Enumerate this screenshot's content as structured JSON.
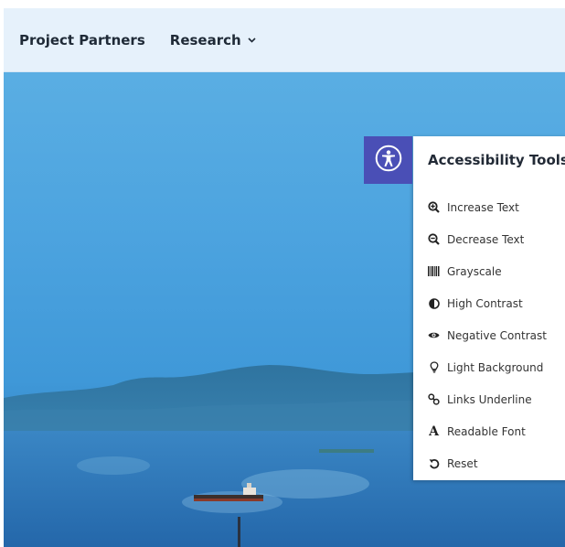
{
  "nav": {
    "items": [
      {
        "label": "Project Partners",
        "dropdown": false
      },
      {
        "label": "Research",
        "dropdown": true
      }
    ]
  },
  "accessibility": {
    "title": "Accessibility Tools",
    "toggle_color": "#4a4fb6",
    "tools": [
      {
        "label": "Increase Text",
        "icon": "zoom-in-icon"
      },
      {
        "label": "Decrease Text",
        "icon": "zoom-out-icon"
      },
      {
        "label": "Grayscale",
        "icon": "barcode-icon"
      },
      {
        "label": "High Contrast",
        "icon": "contrast-icon"
      },
      {
        "label": "Negative Contrast",
        "icon": "eye-icon"
      },
      {
        "label": "Light Background",
        "icon": "lightbulb-icon"
      },
      {
        "label": "Links Underline",
        "icon": "link-icon"
      },
      {
        "label": "Readable Font",
        "icon": "font-icon"
      },
      {
        "label": "Reset",
        "icon": "reset-icon"
      }
    ]
  }
}
